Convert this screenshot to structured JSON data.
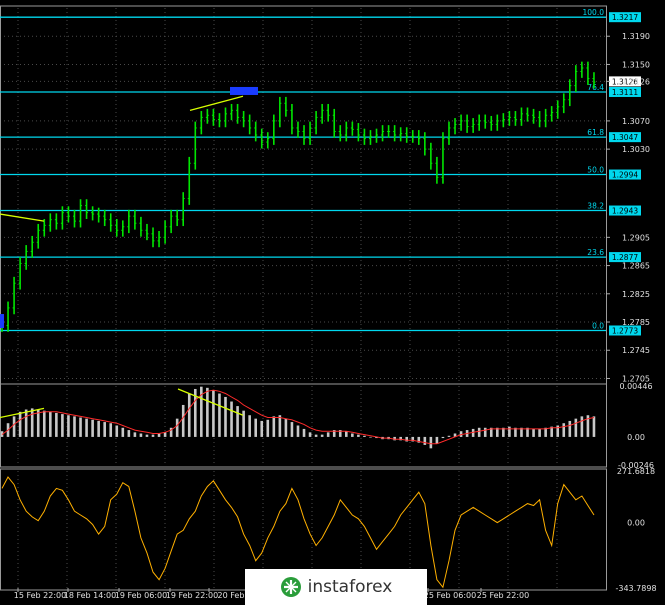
{
  "colors": {
    "background": "#000000",
    "grid": "#4a4a4a",
    "fibo_line": "#00d8ee",
    "price_label": "#00d8ee",
    "price_bars": "#00e600",
    "trendline": "#d7ff00",
    "histogram": "#c8c8c8",
    "signal": "#ff2b2b",
    "cci": "#ffb000",
    "marker": "#1a3cff",
    "axis_text": "#e0e0e0"
  },
  "chart_data": [
    {
      "type": "line",
      "title": "",
      "y_axis_ticks": [
        "1.3190",
        "1.3150",
        "1.3126",
        "1.3070",
        "1.3030",
        "1.2905",
        "1.2865",
        "1.2825",
        "1.2785",
        "1.2745",
        "1.2705"
      ],
      "fibo_levels": [
        {
          "level": "100.0",
          "price": "1.3217",
          "value": 1.3217
        },
        {
          "level": "76.4",
          "price": "1.3111",
          "value": 1.3111
        },
        {
          "level": "61.8",
          "price": "1.3047",
          "value": 1.3047
        },
        {
          "level": "50.0",
          "price": "1.2994",
          "value": 1.2994
        },
        {
          "level": "38.2",
          "price": "1.2943",
          "value": 1.2943
        },
        {
          "level": "23.6",
          "price": "1.2877",
          "value": 1.2877
        },
        {
          "level": "0.0",
          "price": "1.2773",
          "value": 1.2773
        }
      ],
      "current_price": "1.3126",
      "ylim": [
        1.27,
        1.323
      ],
      "x_labels": [
        "15 Feb 22:00",
        "18 Feb 14:00",
        "19 Feb 06:00",
        "19 Feb 22:00",
        "20 Feb",
        "25 Feb 06:00",
        "25 Feb 22:00"
      ],
      "close": [
        1.278,
        1.2805,
        1.284,
        1.2868,
        1.2885,
        1.2898,
        1.2915,
        1.2922,
        1.293,
        1.2925,
        1.294,
        1.2935,
        1.2928,
        1.295,
        1.294,
        1.2938,
        1.2935,
        1.293,
        1.2922,
        1.2915,
        1.292,
        1.2935,
        1.2925,
        1.2915,
        1.291,
        1.29,
        1.2905,
        1.292,
        1.2935,
        1.293,
        1.296,
        1.301,
        1.306,
        1.3075,
        1.3078,
        1.3072,
        1.307,
        1.308,
        1.3085,
        1.3075,
        1.307,
        1.306,
        1.305,
        1.304,
        1.3045,
        1.307,
        1.3095,
        1.3085,
        1.306,
        1.3055,
        1.3045,
        1.306,
        1.3075,
        1.3085,
        1.3078,
        1.3055,
        1.305,
        1.306,
        1.3058,
        1.305,
        1.3045,
        1.3048,
        1.305,
        1.3055,
        1.3055,
        1.305,
        1.3052,
        1.3048,
        1.3048,
        1.3045,
        1.303,
        1.301,
        1.299,
        1.3045,
        1.306,
        1.3065,
        1.307,
        1.3062,
        1.3065,
        1.307,
        1.3068,
        1.3065,
        1.307,
        1.3072,
        1.3075,
        1.3072,
        1.308,
        1.3078,
        1.3075,
        1.307,
        1.3078,
        1.3082,
        1.309,
        1.31,
        1.312,
        1.314,
        1.3145,
        1.313,
        1.3125
      ]
    },
    {
      "type": "bar",
      "title": "",
      "indicator": "MACD",
      "y_axis_ticks": [
        "0.00446",
        "0.00",
        "-0.00246"
      ],
      "ylim": [
        -0.00246,
        0.00446
      ],
      "histogram": [
        0.0005,
        0.0012,
        0.0018,
        0.0022,
        0.0024,
        0.0025,
        0.0024,
        0.0023,
        0.0022,
        0.0021,
        0.002,
        0.0019,
        0.0018,
        0.0017,
        0.0016,
        0.0015,
        0.0014,
        0.0013,
        0.0012,
        0.001,
        0.0008,
        0.0006,
        0.0004,
        0.0003,
        0.0002,
        0.0002,
        0.0003,
        0.0004,
        0.0008,
        0.0016,
        0.0028,
        0.0038,
        0.0042,
        0.0044,
        0.0043,
        0.0041,
        0.0038,
        0.0035,
        0.0031,
        0.0027,
        0.0023,
        0.0019,
        0.0016,
        0.0014,
        0.0015,
        0.0018,
        0.0019,
        0.0016,
        0.0013,
        0.001,
        0.0007,
        0.0004,
        0.0002,
        0.0002,
        0.0004,
        0.0006,
        0.0006,
        0.0005,
        0.0003,
        0.0002,
        0.0001,
        0.0,
        -0.0001,
        -0.0002,
        -0.0002,
        -0.0003,
        -0.0003,
        -0.0004,
        -0.0004,
        -0.0005,
        -0.0007,
        -0.001,
        -0.0006,
        -0.0001,
        0.0001,
        0.0003,
        0.0005,
        0.0006,
        0.0007,
        0.0008,
        0.0008,
        0.0008,
        0.0008,
        0.0008,
        0.0009,
        0.0008,
        0.0008,
        0.0008,
        0.0007,
        0.0007,
        0.0008,
        0.0009,
        0.001,
        0.0012,
        0.0014,
        0.0016,
        0.0018,
        0.0019,
        0.0018
      ],
      "signal": [
        0.0002,
        0.0006,
        0.0011,
        0.0015,
        0.0018,
        0.002,
        0.0021,
        0.0022,
        0.0022,
        0.0022,
        0.0021,
        0.002,
        0.0019,
        0.0018,
        0.0017,
        0.0016,
        0.0015,
        0.0014,
        0.0013,
        0.0012,
        0.001,
        0.0008,
        0.0006,
        0.0005,
        0.0004,
        0.0003,
        0.0003,
        0.0004,
        0.0006,
        0.001,
        0.0017,
        0.0025,
        0.0032,
        0.0037,
        0.004,
        0.0041,
        0.004,
        0.0038,
        0.0035,
        0.0032,
        0.0028,
        0.0025,
        0.0022,
        0.0019,
        0.0017,
        0.0017,
        0.0017,
        0.0016,
        0.0015,
        0.0013,
        0.0011,
        0.0008,
        0.0006,
        0.0005,
        0.0005,
        0.0005,
        0.0005,
        0.0005,
        0.0004,
        0.0003,
        0.0002,
        0.0001,
        0.0,
        -0.0001,
        -0.0001,
        -0.0002,
        -0.0002,
        -0.0003,
        -0.0003,
        -0.0004,
        -0.0005,
        -0.0006,
        -0.0006,
        -0.0004,
        -0.0002,
        0.0,
        0.0002,
        0.0003,
        0.0004,
        0.0005,
        0.0006,
        0.0007,
        0.0007,
        0.0007,
        0.0007,
        0.0007,
        0.0007,
        0.0007,
        0.0007,
        0.0007,
        0.0007,
        0.0008,
        0.0008,
        0.0009,
        0.001,
        0.0012,
        0.0014,
        0.0016,
        0.0017
      ]
    },
    {
      "type": "line",
      "title": "",
      "indicator": "CCI",
      "y_axis_ticks": [
        "271.6818",
        "0.00",
        "-343.7898"
      ],
      "ylim": [
        -343.7898,
        271.6818
      ],
      "values": [
        180,
        240,
        200,
        120,
        60,
        30,
        10,
        60,
        140,
        180,
        170,
        120,
        60,
        40,
        20,
        -10,
        -60,
        -20,
        120,
        150,
        210,
        190,
        60,
        -80,
        -160,
        -260,
        -300,
        -240,
        -150,
        -60,
        -40,
        20,
        60,
        140,
        190,
        220,
        170,
        120,
        80,
        30,
        -60,
        -120,
        -200,
        -160,
        -80,
        -20,
        60,
        100,
        180,
        120,
        20,
        -60,
        -120,
        -80,
        -20,
        40,
        120,
        80,
        40,
        20,
        -20,
        -80,
        -140,
        -100,
        -60,
        -20,
        40,
        80,
        120,
        160,
        100,
        -120,
        -300,
        -340,
        -200,
        -40,
        40,
        60,
        80,
        60,
        40,
        20,
        0,
        20,
        40,
        60,
        80,
        100,
        90,
        120,
        -40,
        -120,
        100,
        200,
        160,
        120,
        140,
        90,
        40
      ]
    }
  ],
  "watermark": {
    "text": "instaforex"
  }
}
